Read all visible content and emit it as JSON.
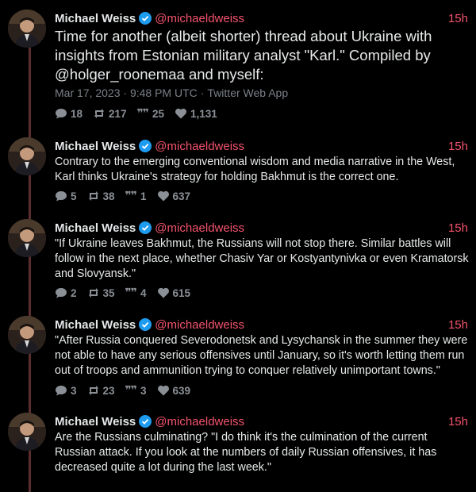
{
  "thread": [
    {
      "name": "Michael Weiss",
      "handle": "@michaeldweiss",
      "time": "15h",
      "text": "Time for another (albeit shorter) thread about Ukraine with insights from Estonian military analyst \"Karl.\" Compiled by @holger_roonemaa and myself:",
      "date": "Mar 17, 2023 · 9:48 PM UTC",
      "client": "Twitter Web App",
      "replies": "18",
      "retweets": "217",
      "quotes": "25",
      "likes": "1,131"
    },
    {
      "name": "Michael Weiss",
      "handle": "@michaeldweiss",
      "time": "15h",
      "text": "Contrary to the emerging conventional wisdom and media narrative in the West, Karl thinks Ukraine's strategy for holding Bakhmut is the correct one.",
      "replies": "5",
      "retweets": "38",
      "quotes": "1",
      "likes": "637"
    },
    {
      "name": "Michael Weiss",
      "handle": "@michaeldweiss",
      "time": "15h",
      "text": "\"If Ukraine leaves Bakhmut, the Russians will not stop there. Similar battles will follow in the next place, whether Chasiv Yar or Kostyantynivka or even Kramatorsk and Slovyansk.\"",
      "replies": "2",
      "retweets": "35",
      "quotes": "4",
      "likes": "615"
    },
    {
      "name": "Michael Weiss",
      "handle": "@michaeldweiss",
      "time": "15h",
      "text": "\"After Russia conquered Severodonetsk and Lysychansk in the summer they were not able to have any serious offensives until January, so it's worth letting them run out of troops and ammunition trying to conquer relatively unimportant towns.\"",
      "replies": "3",
      "retweets": "23",
      "quotes": "3",
      "likes": "639"
    },
    {
      "name": "Michael Weiss",
      "handle": "@michaeldweiss",
      "time": "15h",
      "text": "Are the Russians culminating? \"I do think it's the culmination of the current Russian attack. If you look at the numbers of daily Russian offensives, it has decreased quite a lot during the last week.\""
    }
  ],
  "colors": {
    "background": "#000000",
    "text": "#e7e9ea",
    "accent": "#f4536d",
    "muted": "#8b9096",
    "verified": "#1d9bf0",
    "thread_line": "#5b2e2e"
  },
  "icons": {
    "verified": "verified-badge-icon",
    "reply": "reply-bubble-icon",
    "retweet": "retweet-icon",
    "quote": "quote-icon",
    "like": "heart-icon"
  }
}
